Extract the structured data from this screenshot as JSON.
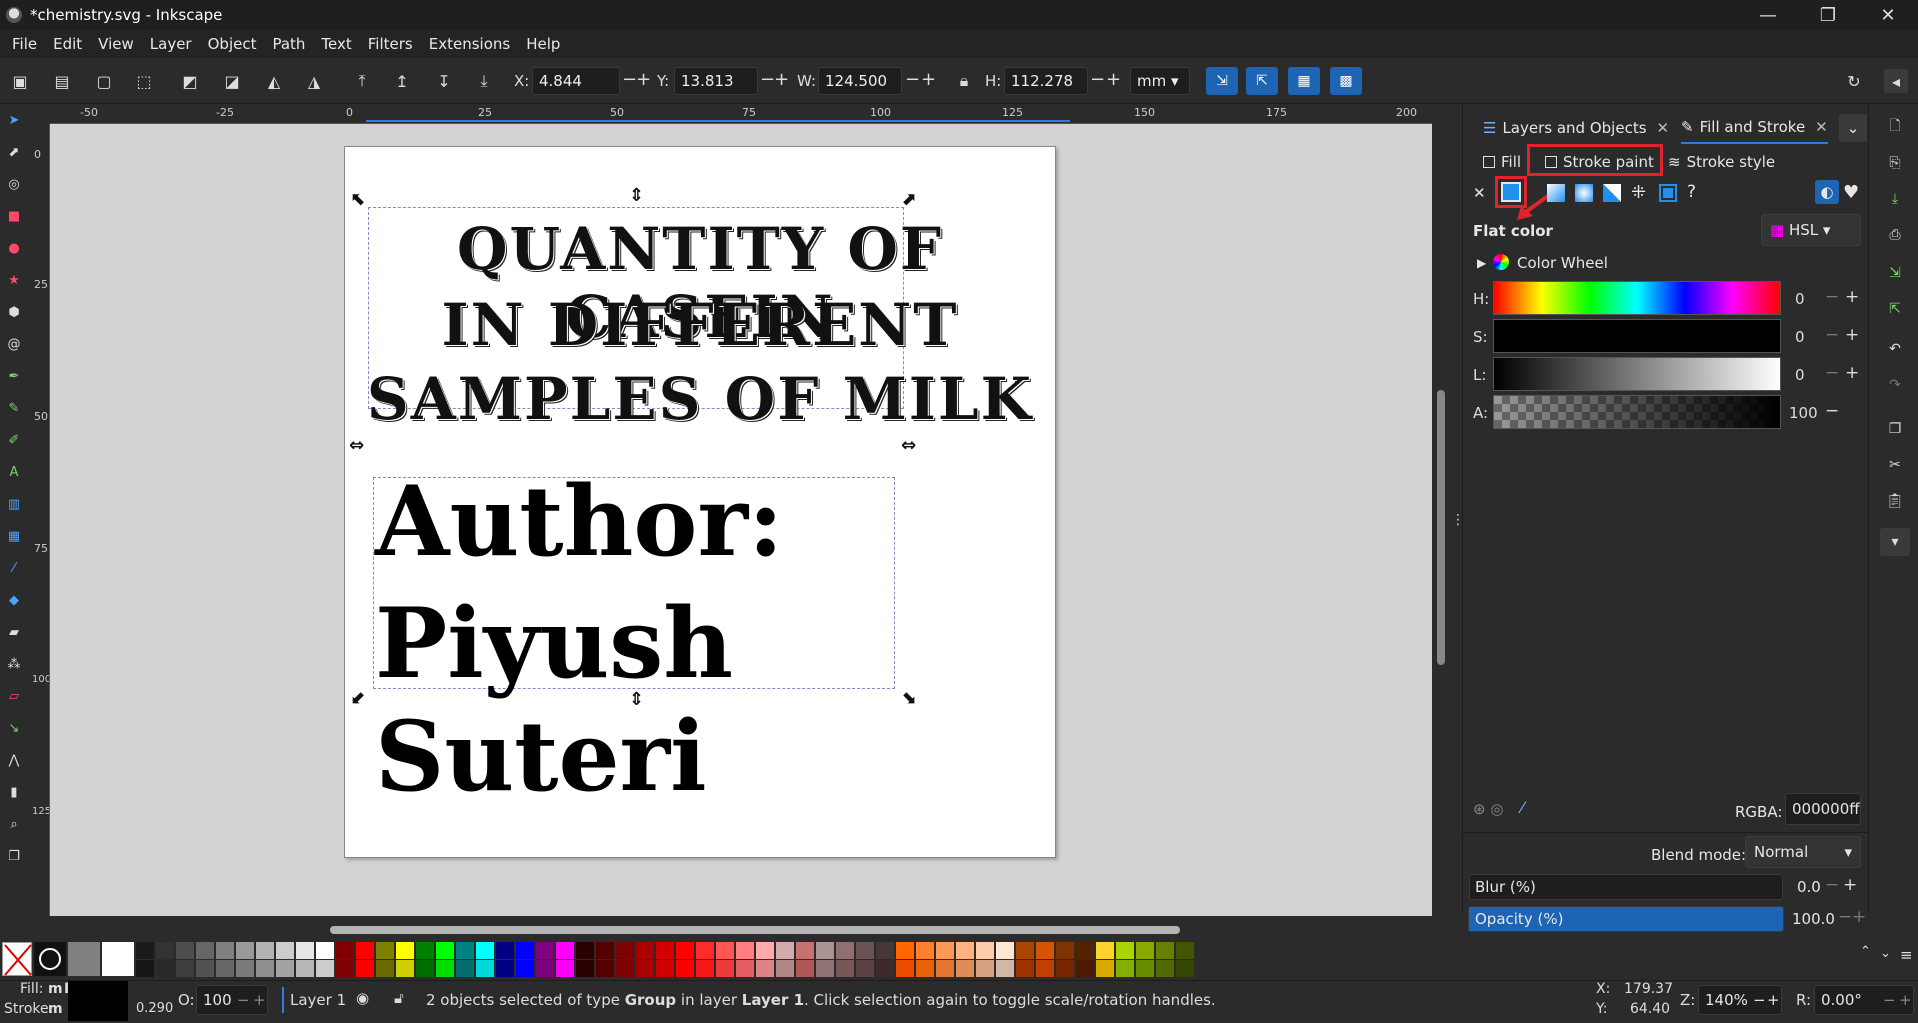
{
  "window": {
    "title": "*chemistry.svg - Inkscape",
    "minimize": "—",
    "maximize": "❐",
    "close": "✕"
  },
  "menu": [
    "File",
    "Edit",
    "View",
    "Layer",
    "Object",
    "Path",
    "Text",
    "Filters",
    "Extensions",
    "Help"
  ],
  "toolbar": {
    "x_label": "X:",
    "x_value": "4.844",
    "y_label": "Y:",
    "y_value": "13.813",
    "w_label": "W:",
    "w_value": "124.500",
    "h_label": "H:",
    "h_value": "112.278",
    "unit": "mm",
    "minus": "−",
    "plus": "+"
  },
  "ruler_top": [
    "-50",
    "-25",
    "0",
    "25",
    "50",
    "75",
    "100",
    "125",
    "150",
    "175",
    "200"
  ],
  "ruler_left": [
    "0",
    "25",
    "50",
    "75",
    "100",
    "125"
  ],
  "document": {
    "title_lines": [
      "QUANTITY OF CASEIN",
      "IN DIFFERENT",
      "SAMPLES OF MILK"
    ],
    "author_line1": "Author:",
    "author_line2": "Piyush Suteri"
  },
  "dock": {
    "tab1": "Layers and Objects",
    "tab2": "Fill and Stroke",
    "fill_tab": "Fill",
    "stroke_paint_tab": "Stroke paint",
    "stroke_style_tab": "Stroke style",
    "flat_color": "Flat color",
    "color_mode": "HSL",
    "color_wheel": "Color Wheel",
    "sliders": [
      {
        "label": "H:",
        "value": "0"
      },
      {
        "label": "S:",
        "value": "0"
      },
      {
        "label": "L:",
        "value": "0"
      },
      {
        "label": "A:",
        "value": "100"
      }
    ],
    "rgba_label": "RGBA:",
    "rgba_value": "000000ff",
    "blend_label": "Blend mode:",
    "blend_value": "Normal",
    "blur_label": "Blur (%)",
    "blur_value": "0.0",
    "opacity_label": "Opacity (%)",
    "opacity_value": "100.0",
    "opacity_level": 1.0
  },
  "palette_colors": [
    "#1a1a1a",
    "#333333",
    "#4d4d4d",
    "#666666",
    "#808080",
    "#999999",
    "#b3b3b3",
    "#cccccc",
    "#e6e6e6",
    "#ffffff",
    "#800000",
    "#ff0000",
    "#808000",
    "#ffff00",
    "#008000",
    "#00ff00",
    "#008080",
    "#00ffff",
    "#000080",
    "#0000ff",
    "#800080",
    "#ff00ff",
    "#2b0000",
    "#550000",
    "#800000",
    "#aa0000",
    "#d40000",
    "#ff0000",
    "#ff2a2a",
    "#ff5555",
    "#ff8080",
    "#ffaaaa",
    "#d5aaaa",
    "#c87171",
    "#ac9393",
    "#916f6f",
    "#6c5353",
    "#483737",
    "#ff6600",
    "#ff7f2a",
    "#ff9955",
    "#ffb380",
    "#ffccaa",
    "#ffe6d5",
    "#aa4400",
    "#d45500",
    "#803300",
    "#552200",
    "#ffd42a",
    "#aad400",
    "#88aa00",
    "#668000",
    "#445500"
  ],
  "statusbar": {
    "fill_label": "Fill:",
    "fill_value": "m",
    "fill_extra": "L",
    "stroke_label": "Stroke:",
    "stroke_value": "m",
    "stroke_width": "0.290",
    "o_label": "O:",
    "o_value": "100",
    "layer": "Layer 1",
    "message_pre": "2 objects selected of type ",
    "message_type": "Group",
    "message_mid": " in layer ",
    "message_layer": "Layer 1",
    "message_post": ". Click selection again to toggle scale/rotation handles.",
    "cursor_x_label": "X:",
    "cursor_x": "179.37",
    "cursor_y_label": "Y:",
    "cursor_y": "64.40",
    "zoom_label": "Z:",
    "zoom": "140%",
    "rot_label": "R:",
    "rotation": "0.00°"
  }
}
